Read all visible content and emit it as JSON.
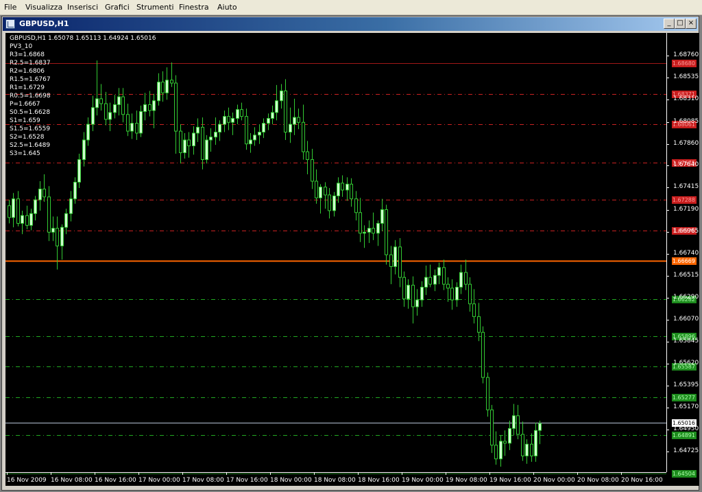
{
  "menu": [
    "File",
    "Visualizza",
    "Inserisci",
    "Grafici",
    "Strumenti",
    "Finestra",
    "Aiuto"
  ],
  "window": {
    "title": "GBPUSD,H1",
    "buttons": [
      "_",
      "□",
      "×"
    ]
  },
  "chart": {
    "symbol_line": "GBPUSD,H1  1.65078 1.65113 1.64924 1.65016",
    "indicator": "PV3_10",
    "current_price": "1.65016",
    "price_axis": [
      "1.68760",
      "1.68535",
      "1.68310",
      "1.68085",
      "1.67860",
      "1.67640",
      "1.67415",
      "1.67190",
      "1.66965",
      "1.66740",
      "1.66515",
      "1.66290",
      "1.66070",
      "1.65845",
      "1.65620",
      "1.65395",
      "1.65170",
      "1.64950",
      "1.64725"
    ],
    "time_axis": [
      "16 Nov 2009",
      "16 Nov 08:00",
      "16 Nov 16:00",
      "17 Nov 00:00",
      "17 Nov 08:00",
      "17 Nov 16:00",
      "18 Nov 00:00",
      "18 Nov 08:00",
      "18 Nov 16:00",
      "19 Nov 00:00",
      "19 Nov 08:00",
      "19 Nov 16:00",
      "20 Nov 00:00",
      "20 Nov 08:00",
      "20 Nov 16:00"
    ],
    "colors": {
      "background": "#000000",
      "bull_candle": "#ccffcc",
      "bear_candle": "#000000",
      "wick": "#33cc33",
      "resistance": "#cc2222",
      "pivot": "#ff6600",
      "support": "#22aa22"
    },
    "levels": [
      {
        "name": "R3",
        "text": "R3=1.6868",
        "price": 1.6868,
        "tag": "1.68680",
        "type": "resistance"
      },
      {
        "name": "R2.5",
        "text": "R2.5=1.6837",
        "price": 1.6837,
        "tag": "1.68371",
        "type": "resistance"
      },
      {
        "name": "R2",
        "text": "R2=1.6806",
        "price": 1.6806,
        "tag": "1.68061",
        "type": "resistance"
      },
      {
        "name": "R1.5",
        "text": "R1.5=1.6767",
        "price": 1.6767,
        "tag": "1.67675",
        "type": "resistance"
      },
      {
        "name": "R1",
        "text": "R1=1.6729",
        "price": 1.6729,
        "tag": "1.67288",
        "type": "resistance"
      },
      {
        "name": "R0.5",
        "text": "R0.5=1.6698",
        "price": 1.6698,
        "tag": "1.66978",
        "type": "resistance"
      },
      {
        "name": "P",
        "text": "P=1.6667",
        "price": 1.6667,
        "tag": "1.66669",
        "type": "pivot"
      },
      {
        "name": "S0.5",
        "text": "S0.5=1.6628",
        "price": 1.6628,
        "tag": "1.66282",
        "type": "support"
      },
      {
        "name": "S1",
        "text": "S1=1.659",
        "price": 1.659,
        "tag": "1.65896",
        "type": "support"
      },
      {
        "name": "S1.5",
        "text": "S1.5=1.6559",
        "price": 1.6559,
        "tag": "1.65587",
        "type": "support"
      },
      {
        "name": "S2",
        "text": "S2=1.6528",
        "price": 1.6528,
        "tag": "1.65277",
        "type": "support"
      },
      {
        "name": "S2.5",
        "text": "S2.5=1.6489",
        "price": 1.6489,
        "tag": "1.64891",
        "type": "support"
      },
      {
        "name": "S3",
        "text": "S3=1.645",
        "price": 1.645,
        "tag": "1.64504",
        "type": "support"
      }
    ]
  },
  "candles": [
    [
      1.6723,
      1.6729,
      1.6705,
      1.6711
    ],
    [
      1.6711,
      1.6736,
      1.6701,
      1.673
    ],
    [
      1.673,
      1.6738,
      1.6702,
      1.6705
    ],
    [
      1.6705,
      1.6718,
      1.6694,
      1.6713
    ],
    [
      1.6713,
      1.6723,
      1.6699,
      1.6703
    ],
    [
      1.6703,
      1.672,
      1.6698,
      1.6715
    ],
    [
      1.6715,
      1.6733,
      1.6708,
      1.6729
    ],
    [
      1.6729,
      1.6748,
      1.6718,
      1.674
    ],
    [
      1.674,
      1.6755,
      1.6727,
      1.6732
    ],
    [
      1.6732,
      1.6743,
      1.6687,
      1.6696
    ],
    [
      1.6696,
      1.6712,
      1.6687,
      1.67
    ],
    [
      1.67,
      1.6712,
      1.6658,
      1.6682
    ],
    [
      1.6682,
      1.6704,
      1.6668,
      1.6701
    ],
    [
      1.6701,
      1.672,
      1.6694,
      1.6715
    ],
    [
      1.6715,
      1.6738,
      1.6707,
      1.673
    ],
    [
      1.673,
      1.6752,
      1.6725,
      1.6747
    ],
    [
      1.6747,
      1.6776,
      1.6741,
      1.677
    ],
    [
      1.677,
      1.6798,
      1.6763,
      1.679
    ],
    [
      1.679,
      1.6813,
      1.6784,
      1.6806
    ],
    [
      1.6806,
      1.6835,
      1.6799,
      1.6823
    ],
    [
      1.6823,
      1.6871,
      1.6815,
      1.6832
    ],
    [
      1.6832,
      1.6847,
      1.682,
      1.6827
    ],
    [
      1.6827,
      1.6839,
      1.6805,
      1.6811
    ],
    [
      1.6811,
      1.6828,
      1.6799,
      1.6818
    ],
    [
      1.6818,
      1.6836,
      1.6812,
      1.6826
    ],
    [
      1.6826,
      1.6843,
      1.6815,
      1.6834
    ],
    [
      1.6834,
      1.6843,
      1.6808,
      1.6816
    ],
    [
      1.6816,
      1.6827,
      1.6794,
      1.6799
    ],
    [
      1.6799,
      1.6817,
      1.6791,
      1.6807
    ],
    [
      1.6807,
      1.682,
      1.679,
      1.6797
    ],
    [
      1.6797,
      1.6825,
      1.6793,
      1.6819
    ],
    [
      1.6819,
      1.6838,
      1.681,
      1.6826
    ],
    [
      1.6826,
      1.684,
      1.6814,
      1.682
    ],
    [
      1.682,
      1.6837,
      1.6802,
      1.683
    ],
    [
      1.683,
      1.6858,
      1.6825,
      1.6849
    ],
    [
      1.6849,
      1.686,
      1.6829,
      1.6838
    ],
    [
      1.6838,
      1.6864,
      1.6831,
      1.6851
    ],
    [
      1.6851,
      1.6869,
      1.6844,
      1.6848
    ],
    [
      1.6848,
      1.6856,
      1.6776,
      1.6799
    ],
    [
      1.6799,
      1.6806,
      1.6766,
      1.6777
    ],
    [
      1.6777,
      1.6797,
      1.6771,
      1.679
    ],
    [
      1.679,
      1.6798,
      1.6772,
      1.6784
    ],
    [
      1.6784,
      1.6804,
      1.6775,
      1.6797
    ],
    [
      1.6797,
      1.6812,
      1.6788,
      1.6803
    ],
    [
      1.6803,
      1.6813,
      1.676,
      1.677
    ],
    [
      1.677,
      1.6795,
      1.6766,
      1.679
    ],
    [
      1.679,
      1.6802,
      1.6778,
      1.6793
    ],
    [
      1.6793,
      1.6813,
      1.6785,
      1.6798
    ],
    [
      1.6798,
      1.681,
      1.6789,
      1.6806
    ],
    [
      1.6806,
      1.682,
      1.6798,
      1.6814
    ],
    [
      1.6814,
      1.6823,
      1.68,
      1.6808
    ],
    [
      1.6808,
      1.6818,
      1.6795,
      1.6812
    ],
    [
      1.6812,
      1.6826,
      1.6806,
      1.6821
    ],
    [
      1.6821,
      1.6828,
      1.681,
      1.6814
    ],
    [
      1.6814,
      1.6822,
      1.678,
      1.6786
    ],
    [
      1.6786,
      1.6797,
      1.6777,
      1.679
    ],
    [
      1.679,
      1.6803,
      1.6784,
      1.6795
    ],
    [
      1.6795,
      1.6806,
      1.6786,
      1.6798
    ],
    [
      1.6798,
      1.6812,
      1.6792,
      1.6807
    ],
    [
      1.6807,
      1.6817,
      1.68,
      1.6812
    ],
    [
      1.6812,
      1.6825,
      1.6806,
      1.6818
    ],
    [
      1.6818,
      1.6846,
      1.681,
      1.683
    ],
    [
      1.683,
      1.6847,
      1.6822,
      1.684
    ],
    [
      1.684,
      1.6852,
      1.679,
      1.6798
    ],
    [
      1.6798,
      1.6823,
      1.6787,
      1.6806
    ],
    [
      1.6806,
      1.6832,
      1.6795,
      1.6813
    ],
    [
      1.6813,
      1.6822,
      1.6801,
      1.6808
    ],
    [
      1.6808,
      1.6826,
      1.677,
      1.6778
    ],
    [
      1.6778,
      1.6789,
      1.6755,
      1.677
    ],
    [
      1.677,
      1.6781,
      1.674,
      1.6748
    ],
    [
      1.6748,
      1.676,
      1.6725,
      1.6731
    ],
    [
      1.6731,
      1.6745,
      1.6715,
      1.6742
    ],
    [
      1.6742,
      1.6747,
      1.672,
      1.6734
    ],
    [
      1.6734,
      1.6741,
      1.671,
      1.6718
    ],
    [
      1.6718,
      1.6737,
      1.6712,
      1.6733
    ],
    [
      1.6733,
      1.6752,
      1.6726,
      1.6746
    ],
    [
      1.6746,
      1.6754,
      1.6732,
      1.6739
    ],
    [
      1.6739,
      1.6752,
      1.6728,
      1.6745
    ],
    [
      1.6745,
      1.6751,
      1.6722,
      1.673
    ],
    [
      1.673,
      1.6738,
      1.6708,
      1.6716
    ],
    [
      1.6716,
      1.6731,
      1.6686,
      1.6695
    ],
    [
      1.6695,
      1.6703,
      1.668,
      1.6696
    ],
    [
      1.6696,
      1.6708,
      1.6685,
      1.67
    ],
    [
      1.67,
      1.6716,
      1.6688,
      1.6695
    ],
    [
      1.6695,
      1.6708,
      1.6682,
      1.6705
    ],
    [
      1.6705,
      1.673,
      1.6697,
      1.6719
    ],
    [
      1.6719,
      1.6724,
      1.6663,
      1.6673
    ],
    [
      1.6673,
      1.6682,
      1.6643,
      1.6661
    ],
    [
      1.6661,
      1.6688,
      1.6653,
      1.6681
    ],
    [
      1.6681,
      1.669,
      1.664,
      1.665
    ],
    [
      1.665,
      1.6656,
      1.662,
      1.6628
    ],
    [
      1.6628,
      1.6648,
      1.6618,
      1.6642
    ],
    [
      1.6642,
      1.6651,
      1.6603,
      1.662
    ],
    [
      1.662,
      1.6638,
      1.6611,
      1.6627
    ],
    [
      1.6627,
      1.6646,
      1.662,
      1.664
    ],
    [
      1.664,
      1.6662,
      1.6632,
      1.665
    ],
    [
      1.665,
      1.6663,
      1.664,
      1.6643
    ],
    [
      1.6643,
      1.6658,
      1.6636,
      1.6652
    ],
    [
      1.6652,
      1.6665,
      1.6643,
      1.666
    ],
    [
      1.666,
      1.6668,
      1.6637,
      1.6643
    ],
    [
      1.6643,
      1.665,
      1.6625,
      1.6639
    ],
    [
      1.6639,
      1.6648,
      1.6617,
      1.6627
    ],
    [
      1.6627,
      1.6645,
      1.662,
      1.664
    ],
    [
      1.664,
      1.6663,
      1.6633,
      1.6655
    ],
    [
      1.6655,
      1.6668,
      1.6637,
      1.6643
    ],
    [
      1.6643,
      1.665,
      1.6615,
      1.6623
    ],
    [
      1.6623,
      1.6638,
      1.6603,
      1.661
    ],
    [
      1.661,
      1.6624,
      1.6585,
      1.6594
    ],
    [
      1.6594,
      1.66,
      1.6542,
      1.6548
    ],
    [
      1.6548,
      1.6553,
      1.6508,
      1.6515
    ],
    [
      1.6515,
      1.652,
      1.6471,
      1.6479
    ],
    [
      1.6479,
      1.6493,
      1.6459,
      1.6465
    ],
    [
      1.6465,
      1.6489,
      1.6457,
      1.6483
    ],
    [
      1.6483,
      1.6494,
      1.6468,
      1.6481
    ],
    [
      1.6481,
      1.6504,
      1.6474,
      1.6496
    ],
    [
      1.6496,
      1.6521,
      1.6489,
      1.6509
    ],
    [
      1.6509,
      1.652,
      1.6485,
      1.649
    ],
    [
      1.649,
      1.6503,
      1.6463,
      1.6468
    ],
    [
      1.6468,
      1.6485,
      1.646,
      1.648
    ],
    [
      1.648,
      1.6491,
      1.6462,
      1.6468
    ],
    [
      1.6468,
      1.6502,
      1.6462,
      1.6494
    ],
    [
      1.6494,
      1.6504,
      1.648,
      1.6501
    ]
  ]
}
